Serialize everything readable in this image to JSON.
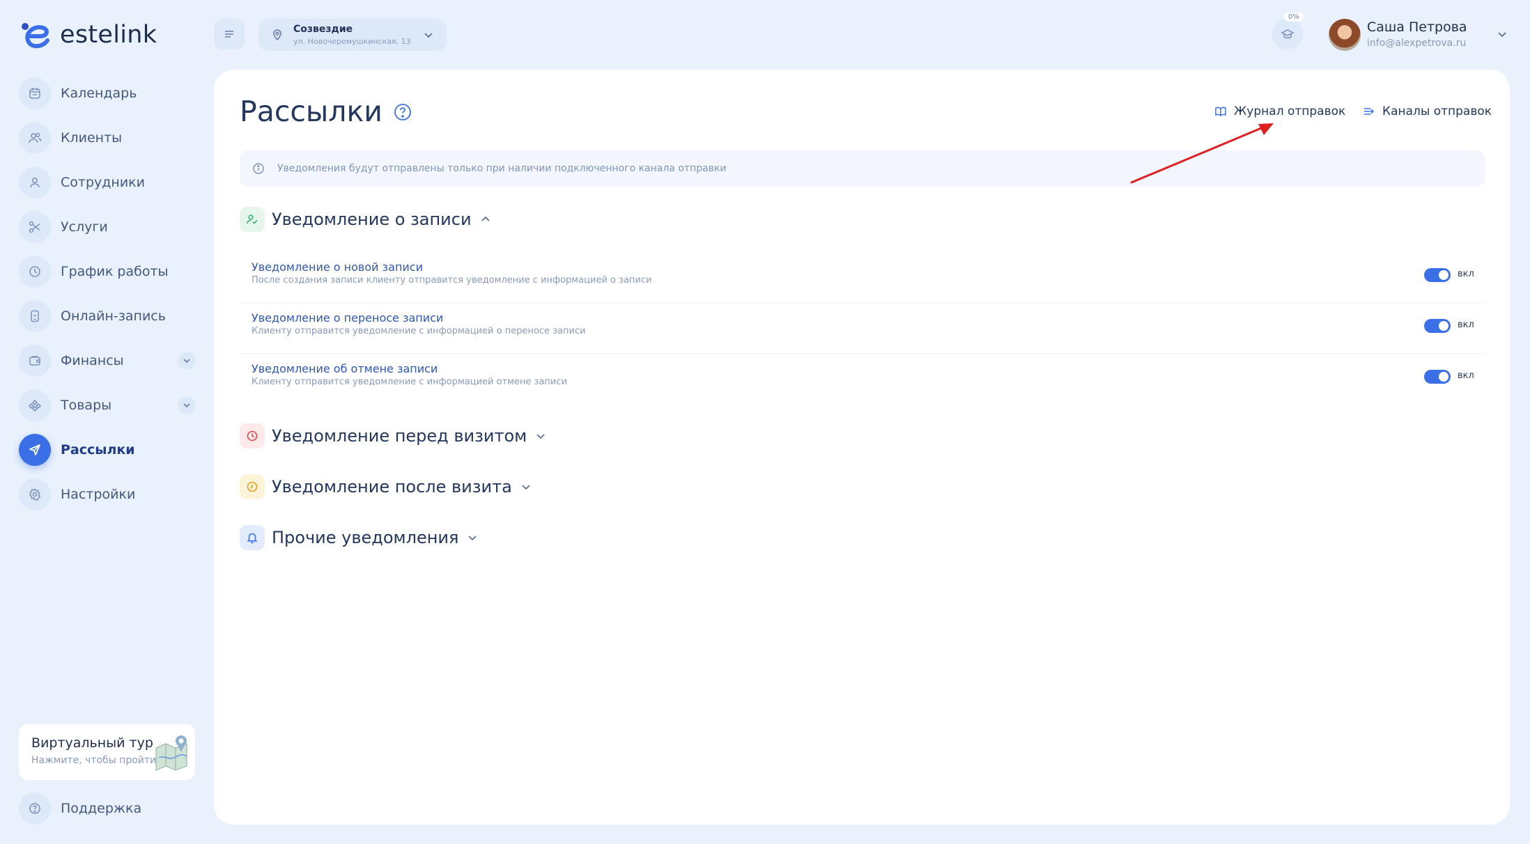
{
  "brand": {
    "name": "estelink",
    "accent": "#3a6fe8"
  },
  "sidebar": {
    "items": [
      {
        "label": "Календарь",
        "icon": "calendar-icon"
      },
      {
        "label": "Клиенты",
        "icon": "users-icon"
      },
      {
        "label": "Сотрудники",
        "icon": "user-icon"
      },
      {
        "label": "Услуги",
        "icon": "scissors-icon"
      },
      {
        "label": "График работы",
        "icon": "clock-icon"
      },
      {
        "label": "Онлайн-запись",
        "icon": "phone-icon"
      },
      {
        "label": "Финансы",
        "icon": "wallet-icon",
        "expandable": true
      },
      {
        "label": "Товары",
        "icon": "box-icon",
        "expandable": true
      },
      {
        "label": "Рассылки",
        "icon": "send-icon",
        "active": true
      },
      {
        "label": "Настройки",
        "icon": "gear-icon"
      }
    ],
    "tour": {
      "title": "Виртуальный тур",
      "subtitle": "Нажмите, чтобы пройти"
    },
    "support": {
      "label": "Поддержка"
    }
  },
  "topbar": {
    "location": {
      "name": "Созвездие",
      "address": "ул. Новочеремушкинская, 13"
    },
    "progress_badge": "0%",
    "user": {
      "name": "Саша Петрова",
      "email": "info@alexpetrova.ru"
    }
  },
  "main": {
    "title": "Рассылки",
    "links": {
      "journal": "Журнал отправок",
      "channels": "Каналы отправок"
    },
    "info": "Уведомления будут отправлены только при наличии подключенного канала отправки",
    "sections": [
      {
        "title": "Уведомление о записи",
        "expanded": true,
        "icon": "user-check-icon",
        "color": "#2fb56b",
        "bg": "#e6f6ec"
      },
      {
        "title": "Уведомление перед визитом",
        "expanded": false,
        "icon": "clock-icon",
        "color": "#e5484d",
        "bg": "#fde8ea"
      },
      {
        "title": "Уведомление после визита",
        "expanded": false,
        "icon": "clock-icon",
        "color": "#e0a11b",
        "bg": "#fdf3d9"
      },
      {
        "title": "Прочие уведомления",
        "expanded": false,
        "icon": "bell-icon",
        "color": "#3a6fe8",
        "bg": "#e3ecfb"
      }
    ],
    "rows": [
      {
        "title": "Уведомление о новой записи",
        "desc": "После создания записи клиенту отправится уведомление с информацией о записи",
        "toggle": "вкл",
        "on": true
      },
      {
        "title": "Уведомление о переносе записи",
        "desc": "Клиенту отправится уведомление с информацией о переносе записи",
        "toggle": "вкл",
        "on": true
      },
      {
        "title": "Уведомление об отмене записи",
        "desc": "Клиенту отправится уведомление с информацией отмене записи",
        "toggle": "вкл",
        "on": true
      }
    ]
  }
}
